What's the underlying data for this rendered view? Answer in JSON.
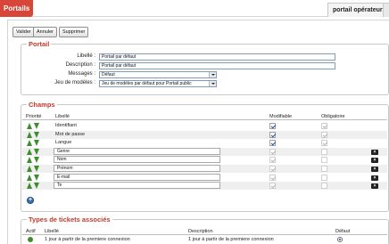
{
  "tabs": {
    "active": "Portails",
    "right": "portail opérateur"
  },
  "toolbar": {
    "valider": "Valider",
    "annuler": "Annuler",
    "supprimer": "Supprimer"
  },
  "portail": {
    "legend": "Portail",
    "libelle_label": "Libellé :",
    "libelle_value": "Portail par défaut",
    "description_label": "Description :",
    "description_value": "Portail par défaut",
    "messages_label": "Messages :",
    "messages_value": "Défaut",
    "jeu_label": "Jeu de modèles :",
    "jeu_value": "Jeu de modèles par défaut pour Portail public"
  },
  "champs": {
    "legend": "Champs",
    "headers": {
      "priorite": "Priorité",
      "libelle": "Libellé",
      "modifiable": "Modifiable",
      "obligatoire": "Obligatoire"
    },
    "rows": [
      {
        "label": "Identifiant",
        "editable": false,
        "modifiable": true,
        "modifiable_enabled": true,
        "obligatoire": true,
        "deletable": false
      },
      {
        "label": "Mot de passe",
        "editable": false,
        "modifiable": true,
        "modifiable_enabled": true,
        "obligatoire": true,
        "deletable": false
      },
      {
        "label": "Langue",
        "editable": false,
        "modifiable": true,
        "modifiable_enabled": true,
        "obligatoire": true,
        "deletable": false
      },
      {
        "label": "Genre",
        "editable": true,
        "modifiable": true,
        "modifiable_enabled": false,
        "obligatoire": false,
        "deletable": true
      },
      {
        "label": "Nom",
        "editable": true,
        "modifiable": true,
        "modifiable_enabled": false,
        "obligatoire": false,
        "deletable": true
      },
      {
        "label": "Prénom",
        "editable": true,
        "modifiable": true,
        "modifiable_enabled": false,
        "obligatoire": false,
        "deletable": true
      },
      {
        "label": "E-mail",
        "editable": true,
        "modifiable": true,
        "modifiable_enabled": false,
        "obligatoire": false,
        "deletable": true
      },
      {
        "label": "Te",
        "editable": true,
        "modifiable": true,
        "modifiable_enabled": false,
        "obligatoire": false,
        "deletable": true
      }
    ]
  },
  "tickets": {
    "legend": "Types de tickets associés",
    "headers": {
      "actif": "Actif",
      "libelle": "Libellé",
      "description": "Description",
      "defaut": "Défaut"
    },
    "rows": [
      {
        "libelle": "1 jour à partir de la premiere connexion",
        "description": "1 jour à partir de la premiere connexion",
        "defaut": true
      }
    ]
  },
  "colors": {
    "accent": "#d8463a",
    "legend": "#c0392b",
    "arrows": "#3c8f2c"
  },
  "icons": [
    "arrow-up-icon",
    "arrow-down-icon",
    "delete-icon",
    "add-icon",
    "active-icon",
    "radio-icon",
    "dropdown-arrow-icon"
  ]
}
